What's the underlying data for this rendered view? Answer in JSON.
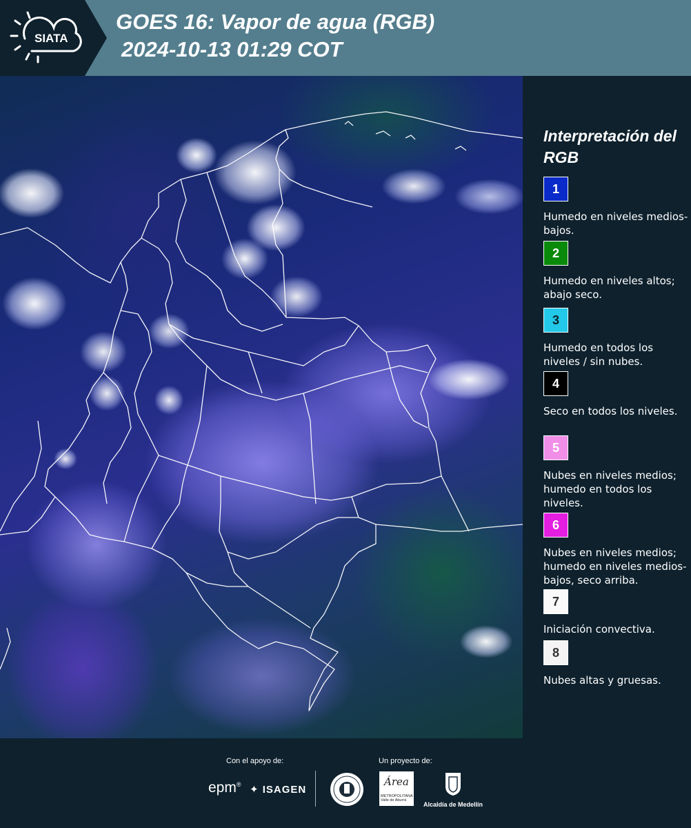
{
  "header": {
    "logo_text": "SIATA",
    "title_line1": "GOES 16: Vapor de agua (RGB)",
    "title_line2": "2024-10-13 01:29 COT",
    "background_color": "#547e8e"
  },
  "map": {
    "content": "GOES-16 water vapor RGB satellite image over Colombia with department boundaries"
  },
  "legend": {
    "title": "Interpretación del RGB",
    "items": [
      {
        "number": "1",
        "color": "#0a2bc9",
        "text_color": "#ffffff",
        "description": "Humedo en niveles medios-bajos."
      },
      {
        "number": "2",
        "color": "#0a8a0a",
        "text_color": "#ffffff",
        "description": "Humedo en niveles altos; abajo seco."
      },
      {
        "number": "3",
        "color": "#22c9e8",
        "text_color": "#0e212d",
        "description": "Humedo en todos los niveles / sin nubes."
      },
      {
        "number": "4",
        "color": "#000000",
        "text_color": "#ffffff",
        "description": "Seco en todos los niveles."
      },
      {
        "number": "5",
        "color": "#f08ee8",
        "text_color": "#ffffff",
        "description": "Nubes en niveles medios; humedo en todos los niveles."
      },
      {
        "number": "6",
        "color": "#e31ee0",
        "text_color": "#ffffff",
        "description": "Nubes en niveles medios; humedo en niveles medios-bajos, seco arriba."
      },
      {
        "number": "7",
        "color": "#fafafa",
        "text_color": "#333333",
        "description": "Iniciación convectiva."
      },
      {
        "number": "8",
        "color": "#f4f4f4",
        "text_color": "#333333",
        "description": "Nubes altas y gruesas."
      }
    ]
  },
  "footer": {
    "support_label": "Con el apoyo de:",
    "project_label": "Un proyecto de:",
    "epm": "epm",
    "isagen": "ISAGEN",
    "area_logo_word": "Área",
    "area_logo_sub": "METROPOLITANA Valle de Aburrá",
    "medellin_label": "Alcaldía de Medellín"
  }
}
